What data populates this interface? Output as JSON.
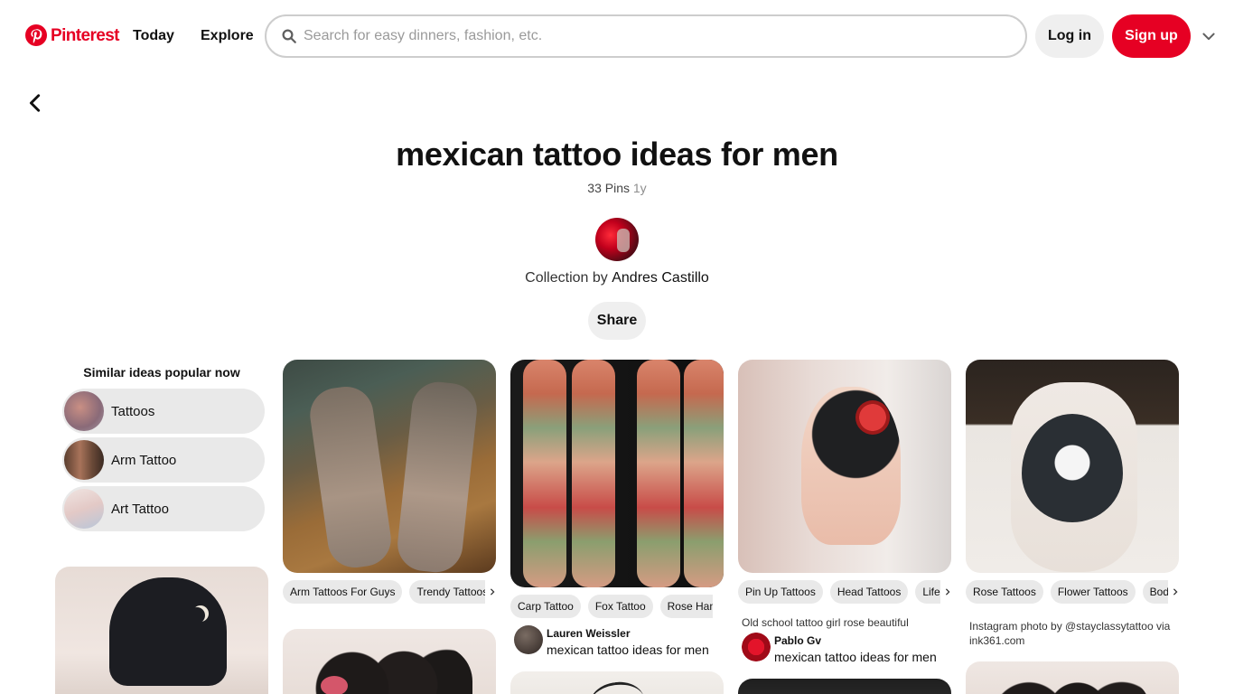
{
  "header": {
    "brand": "Pinterest",
    "nav": [
      "Today",
      "Explore"
    ],
    "search_placeholder": "Search for easy dinners, fashion, etc.",
    "login_label": "Log in",
    "signup_label": "Sign up"
  },
  "board": {
    "title": "mexican tattoo ideas for men",
    "pin_count": "33 Pins",
    "age": "1y",
    "collection_prefix": "Collection by",
    "owner": "Andres Castillo",
    "share_label": "Share"
  },
  "similar_ideas": {
    "title": "Similar ideas popular now",
    "items": [
      "Tattoos",
      "Arm Tattoo",
      "Art Tattoo"
    ]
  },
  "pins": {
    "col1_top": {
      "chips": [
        "Arm Tattoos For Guys",
        "Trendy Tattoos"
      ]
    },
    "col2_top": {
      "chips": [
        "Carp Tattoo",
        "Fox Tattoo",
        "Rose Hand Tattoo"
      ],
      "attribution": {
        "name": "Lauren Weissler",
        "board": "mexican tattoo ideas for men"
      }
    },
    "col3_top": {
      "chips": [
        "Pin Up Tattoos",
        "Head Tattoos",
        "Life Tattoos"
      ],
      "caption": "Old school tattoo girl rose beautiful",
      "attribution": {
        "name": "Pablo Gv",
        "board": "mexican tattoo ideas for men"
      }
    },
    "col4_top": {
      "chips": [
        "Rose Tattoos",
        "Flower Tattoos",
        "Body Tattoos"
      ],
      "caption": "Instagram photo by @stayclassytattoo via ink361.com"
    }
  },
  "colors": {
    "brand_red": "#e60023",
    "chip_bg": "#e9e9e9",
    "button_bg": "#efefef"
  },
  "icons": {
    "logo": "pinterest-logo-icon",
    "search": "search-icon",
    "more": "chevron-down-icon",
    "back": "back-arrow-icon",
    "chip_more": "chevron-right-icon"
  }
}
